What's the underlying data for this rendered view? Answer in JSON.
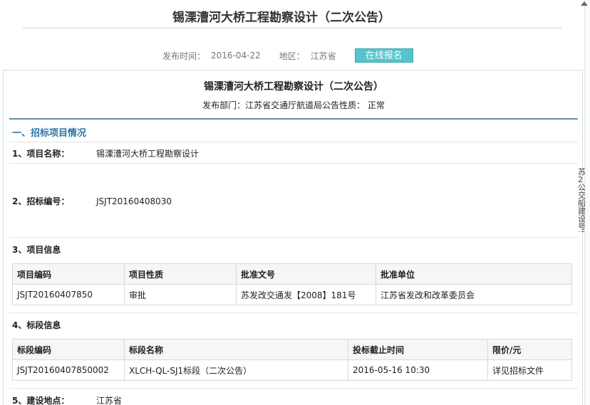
{
  "page": {
    "title": "锡溧漕河大桥工程勘察设计（二次公告）",
    "publish_time_label": "发布时间：",
    "publish_time": "2016-04-22",
    "region_label": "地区：",
    "region": "江苏省",
    "signup_button": "在线报名"
  },
  "notice": {
    "title": "锡溧漕河大桥工程勘察设计（二次公告）",
    "dept_line": "发布部门：江苏省交通厅航道局公告性质：  正常",
    "section1_heading": "一、招标项目情况",
    "item1_label": "1、项目名称：",
    "item1_value": "锡溧漕河大桥工程勘察设计",
    "item2_label": "2、招标编号：",
    "item2_value": "JSJT20160408030",
    "item3_label": "3、项目信息",
    "project_table": {
      "headers": [
        "项目编码",
        "项目性质",
        "批准文号",
        "批准单位"
      ],
      "row": [
        "JSJT20160407850",
        "审批",
        "苏发改交通发【2008】181号",
        "江苏省发改和改革委员会"
      ]
    },
    "item4_label": "4、标段信息",
    "section_table": {
      "headers": [
        "标段编码",
        "标段名称",
        "投标截止时间",
        "限价/元"
      ],
      "row": [
        "JSJT20160407850002",
        "XLCH-QL-SJ1标段（二次公告）",
        "2016-05-16 10:30",
        "详见招标文件"
      ]
    },
    "item5_label": "5、建设地点：",
    "item5_value": "江苏省"
  },
  "side": {
    "text": "苏2公交船建设号JS"
  }
}
